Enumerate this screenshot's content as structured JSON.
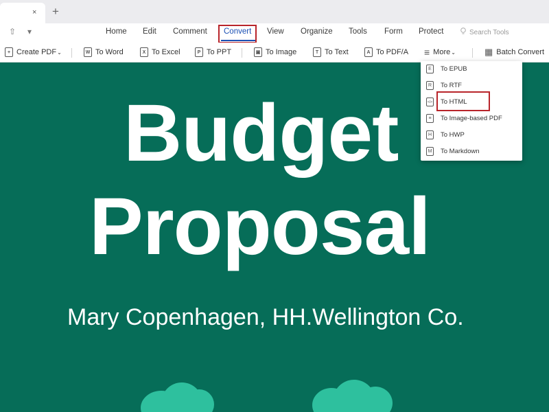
{
  "tabbar": {
    "close_icon": "×",
    "new_tab_icon": "+"
  },
  "quick_access": {
    "share_icon": "⇧",
    "dropdown_icon": "▾"
  },
  "menu": {
    "items": [
      "Home",
      "Edit",
      "Comment",
      "Convert",
      "View",
      "Organize",
      "Tools",
      "Form",
      "Protect"
    ],
    "active": "Convert",
    "search_placeholder": "Search Tools",
    "search_icon": "bulb-icon"
  },
  "toolbar": {
    "create_pdf": "Create PDF",
    "dropdown_caret": "⌄",
    "to_word": "To Word",
    "to_excel": "To Excel",
    "to_ppt": "To PPT",
    "to_image": "To Image",
    "to_text": "To Text",
    "to_pdfa": "To PDF/A",
    "more": "More",
    "batch_convert": "Batch Convert",
    "icons": {
      "create": "+",
      "word": "W",
      "excel": "X",
      "ppt": "P",
      "image": "▣",
      "text": "T",
      "pdfa": "A",
      "more": "≡",
      "batch": "▦"
    }
  },
  "more_dropdown": {
    "items": [
      {
        "label": "To EPUB",
        "icon": "E"
      },
      {
        "label": "To RTF",
        "icon": "R"
      },
      {
        "label": "To HTML",
        "icon": "</>"
      },
      {
        "label": "To Image-based PDF",
        "icon": "≡"
      },
      {
        "label": "To HWP",
        "icon": "H"
      },
      {
        "label": "To Markdown",
        "icon": "M"
      }
    ],
    "highlighted": "To HTML"
  },
  "slide": {
    "title_line1": "Budget",
    "title_line2": "Proposal",
    "subtitle": "Mary Copenhagen, HH.Wellington Co.",
    "background": "#066d58",
    "accent": "#2ec09e"
  },
  "colors": {
    "highlight_box": "#b8242a",
    "active_tab": "#1a4fb4"
  }
}
